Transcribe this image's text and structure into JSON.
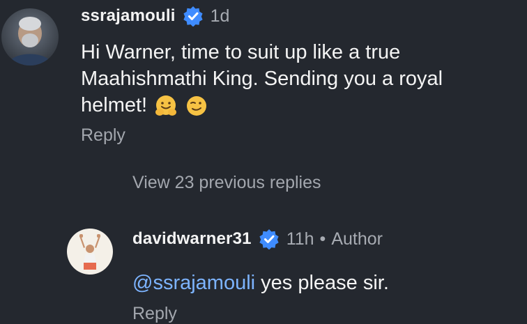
{
  "thread": {
    "main_comment": {
      "username": "ssrajamouli",
      "time": "1d",
      "text": "Hi Warner, time to suit up like a true Maahishmathi King. Sending you a royal helmet!",
      "emojis": [
        "hugging-face",
        "winking-face"
      ],
      "reply_label": "Reply",
      "verified": true
    },
    "view_replies_label": "View 23 previous replies",
    "reply_comment": {
      "username": "davidwarner31",
      "time": "11h",
      "separator": "•",
      "author_badge": "Author",
      "mention": "@ssrajamouli",
      "text": " yes please sir.",
      "reply_label": "Reply",
      "verified": true
    }
  },
  "colors": {
    "background": "#24282f",
    "text_primary": "#f4f4f4",
    "text_secondary": "#a7abb2",
    "mention": "#7db4ff",
    "verified_badge": "#3f8cff"
  }
}
